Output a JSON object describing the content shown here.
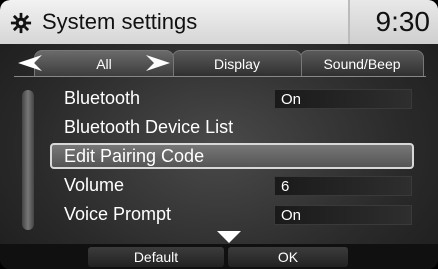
{
  "header": {
    "title": "System settings",
    "clock": "9:30",
    "icon": "gear-icon"
  },
  "tabs": [
    {
      "label": "All",
      "active": true
    },
    {
      "label": "Display",
      "active": false
    },
    {
      "label": "Sound/Beep",
      "active": false
    }
  ],
  "list": {
    "items": [
      {
        "label": "Bluetooth",
        "value": "On"
      },
      {
        "label": "Bluetooth Device List",
        "value": ""
      },
      {
        "label": "Edit Pairing Code",
        "value": "",
        "selected": true
      },
      {
        "label": "Volume",
        "value": "6"
      },
      {
        "label": "Voice Prompt",
        "value": "On"
      }
    ]
  },
  "footer": {
    "default_label": "Default",
    "ok_label": "OK"
  }
}
